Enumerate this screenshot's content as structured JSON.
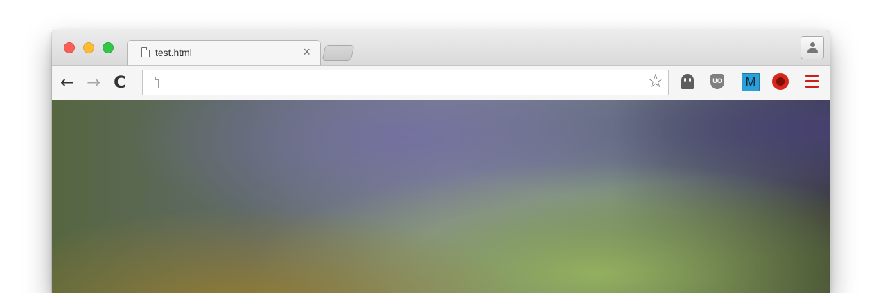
{
  "window": {
    "traffic_lights": [
      "close",
      "minimize",
      "zoom"
    ],
    "profile_icon": "person-icon"
  },
  "tabs": [
    {
      "title": "test.html",
      "icon": "page-icon",
      "close_label": "×"
    }
  ],
  "toolbar": {
    "back_label": "←",
    "forward_label": "→",
    "reload_label": "C",
    "address_value": "",
    "bookmark_icon": "star-icon",
    "extensions": [
      "ghost-icon",
      "ublock-shield-icon",
      "m-extension-icon",
      "red-circle-extension-icon"
    ],
    "shield_label": "UO",
    "m_label": "M",
    "menu_icon": "hamburger-menu-icon"
  },
  "content": {
    "description_colors": {
      "green": "#566640",
      "purple": "#73709f",
      "light_green": "#96b45f",
      "dark": "#2d3223"
    }
  }
}
